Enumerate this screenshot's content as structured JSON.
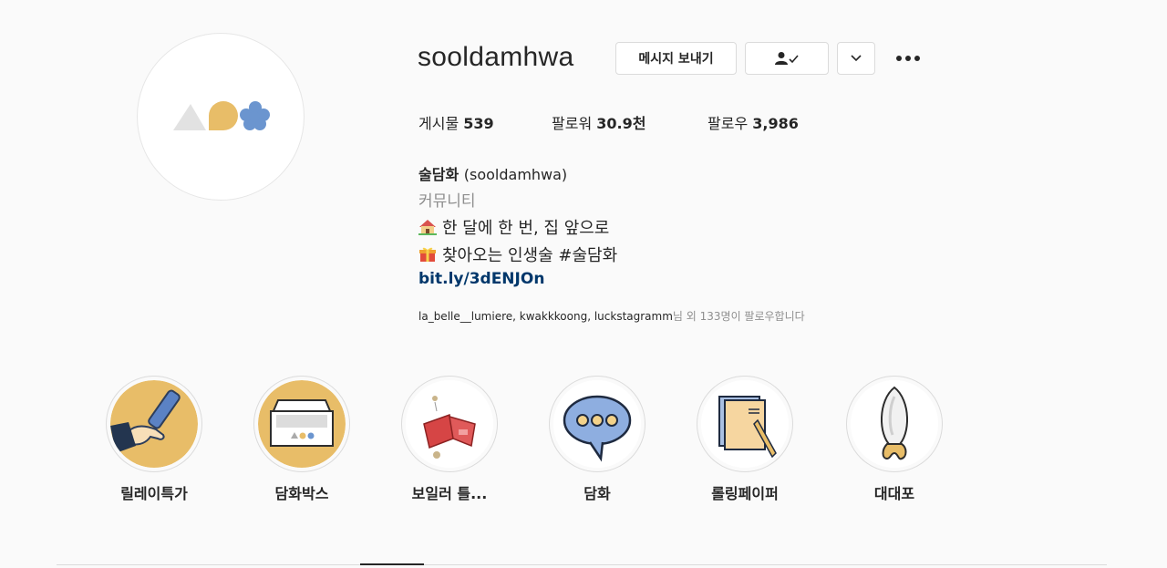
{
  "profile": {
    "username": "sooldamhwa",
    "message_button": "메시지 보내기"
  },
  "stats": {
    "posts_label": "게시물",
    "posts_count": "539",
    "followers_label": "팔로워",
    "followers_count": "30.9천",
    "following_label": "팔로우",
    "following_count": "3,986"
  },
  "bio": {
    "name": "술담화",
    "handle": "(sooldamhwa)",
    "category": "커뮤니티",
    "line1": "한 달에 한 번, 집 앞으로",
    "line2": "찾아오는 인생술 #술담화",
    "link": "bit.ly/3dENJOn"
  },
  "followed_by": {
    "names": "la_belle__lumiere, kwakkkoong, luckstagramm",
    "suffix": "님 외 133명이 팔로우합니다"
  },
  "highlights": [
    {
      "label": "릴레이특가",
      "icon": "relay-baton-icon"
    },
    {
      "label": "담화박스",
      "icon": "box-icon"
    },
    {
      "label": "보일러 틀...",
      "icon": "boiler-icon"
    },
    {
      "label": "담화",
      "icon": "speech-bubble-icon"
    },
    {
      "label": "롤링페이퍼",
      "icon": "rolling-paper-icon"
    },
    {
      "label": "대대포",
      "icon": "rice-grain-icon"
    }
  ],
  "colors": {
    "accent_yellow": "#e8bd68",
    "accent_blue": "#6b95cf",
    "link": "#00376b"
  }
}
